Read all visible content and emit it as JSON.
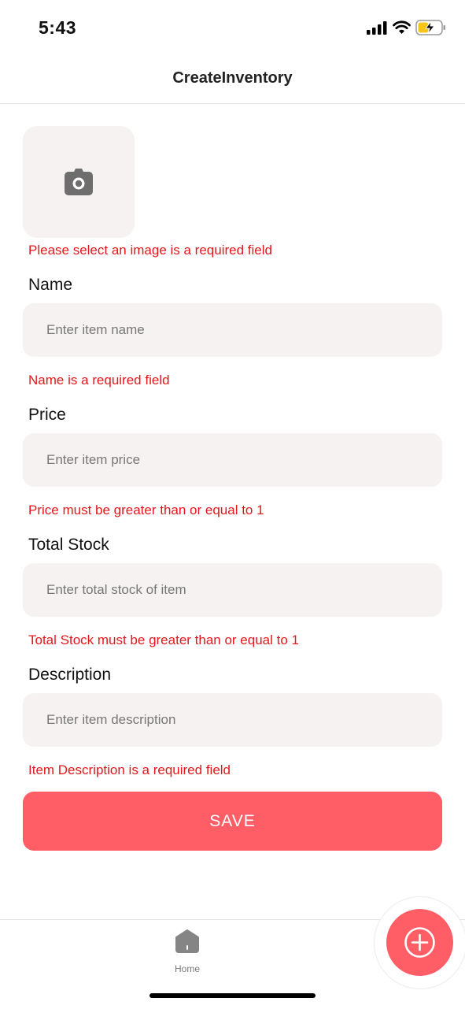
{
  "status_bar": {
    "time": "5:43",
    "icons": [
      "cellular-signal-icon",
      "wifi-icon",
      "battery-charging-icon"
    ],
    "battery_color": "#f5c518"
  },
  "header": {
    "title": "CreateInventory"
  },
  "image_picker": {
    "icon": "camera-icon",
    "error": "Please select an image is a required field"
  },
  "form": {
    "name": {
      "label": "Name",
      "placeholder": "Enter item name",
      "value": "",
      "error": "Name is a required field"
    },
    "price": {
      "label": "Price",
      "placeholder": "Enter item price",
      "value": "",
      "error": "Price must be greater than or equal to 1"
    },
    "stock": {
      "label": "Total Stock",
      "placeholder": "Enter total stock of item",
      "value": "",
      "error": "Total Stock must be greater than or equal to 1"
    },
    "description": {
      "label": "Description",
      "placeholder": "Enter item description",
      "value": "",
      "error": "Item Description is a required field"
    },
    "save_label": "SAVE"
  },
  "tab_bar": {
    "home_label": "Home",
    "home_icon": "home-icon",
    "fab_icon": "plus-circle-icon"
  },
  "colors": {
    "accent": "#ff5e67",
    "error": "#e3171c",
    "field_background": "#f6f2f1"
  }
}
